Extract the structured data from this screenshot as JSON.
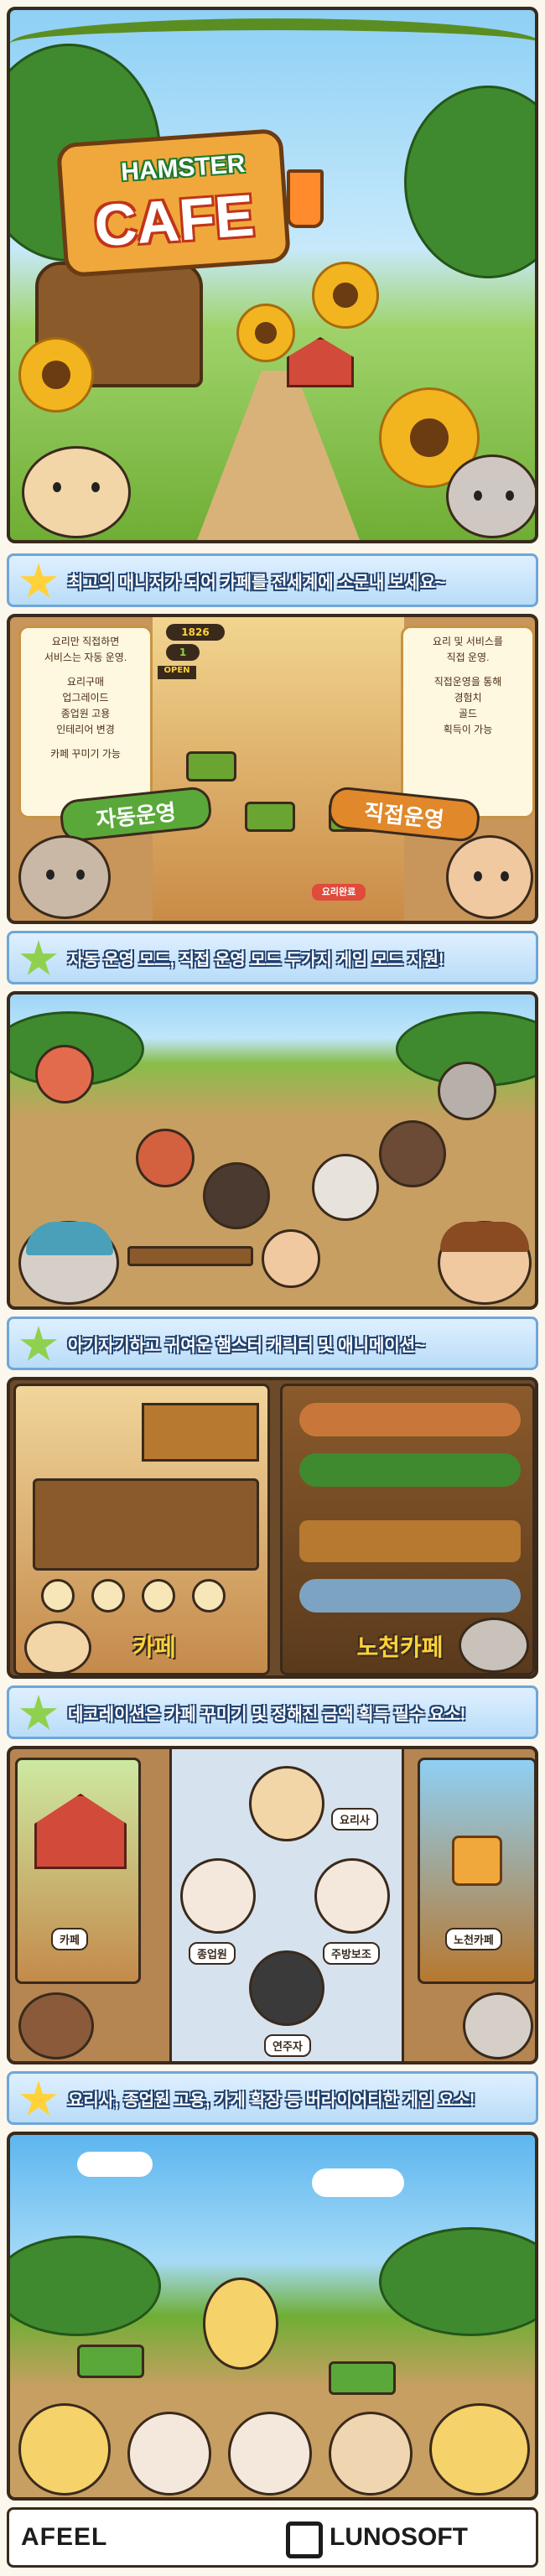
{
  "title_sign": {
    "line1": "HAMSTER",
    "line2": "CAFE"
  },
  "banners": [
    {
      "text": "최고의 매니저가 되어 카페를 전세계에 소문내 보세요~"
    },
    {
      "text": "자동 운영 모드, 직접 운영 모드 두가지 게임 모드 지원!"
    },
    {
      "text": "아기자기하고 귀여운 햄스터 캐릭터 및 애니메이션~"
    },
    {
      "text": "데코레이션은 카페 꾸미기 및 정해진 금액 획득 필수 요소!"
    },
    {
      "text": "요리사, 종업원 고용, 가게 확장 등 버라이어티한 게임 요소!"
    }
  ],
  "modes": {
    "auto": {
      "label": "자동운영",
      "lines": [
        "요리만 직접하면",
        "서비스는 자동 운영.",
        "요리구매",
        "업그레이드",
        "종업원 고용",
        "인테리어 변경",
        "카페 꾸미기 가능"
      ]
    },
    "manual": {
      "label": "직접운영",
      "lines": [
        "요리 및 서비스를",
        "직접 운영.",
        "직접운영을 통해",
        "경험치",
        "골드",
        "획득이 가능"
      ]
    },
    "hud": {
      "gold": "1826",
      "exp": "1",
      "sign": "OPEN",
      "kitchen_label": "요리완료"
    }
  },
  "scenes": {
    "cafe_label": "카페",
    "outdoor_label": "노천카페"
  },
  "characters": {
    "chef": "요리사",
    "waiter": "종업원",
    "kitchen": "주방보조",
    "player": "연주자"
  },
  "decor_labels": {
    "cafe": "카페",
    "outdoor": "노천카페"
  },
  "footer": {
    "left_logo": "AFEEL",
    "right_logo": "LUNOSOFT"
  },
  "colors": {
    "sky": "#7cc8f2",
    "grass": "#7cbf3e",
    "wood": "#8a5a2b",
    "banner_text_outline": "#1e3f6e"
  }
}
